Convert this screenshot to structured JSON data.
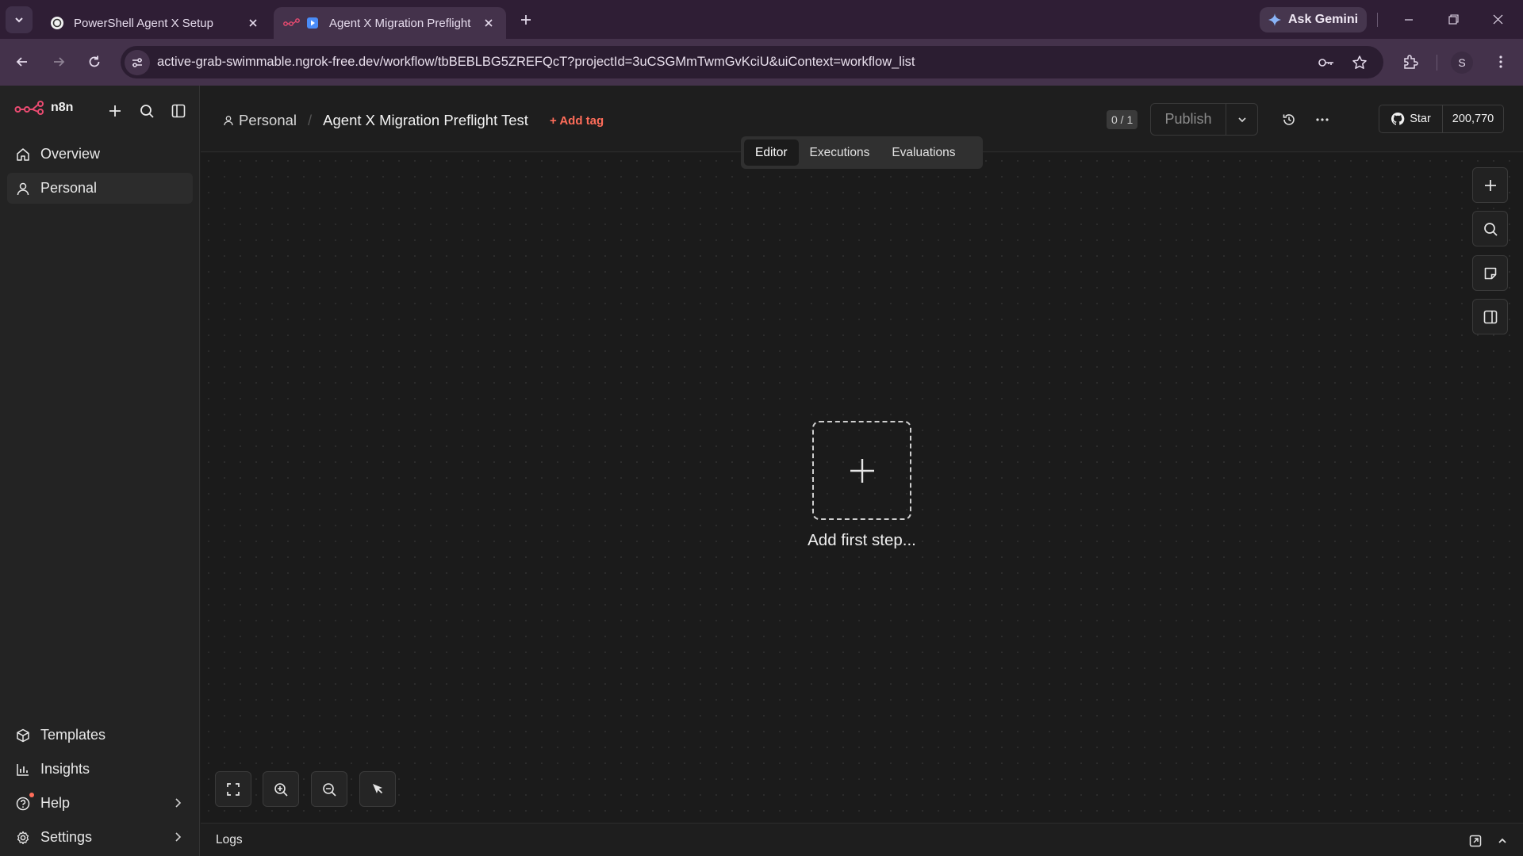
{
  "browser": {
    "tabs": [
      {
        "title": "PowerShell Agent X Setup",
        "active": false
      },
      {
        "title": "Agent X Migration Preflight",
        "active": true
      }
    ],
    "gemini_label": "Ask Gemini",
    "url": "active-grab-swimmable.ngrok-free.dev/workflow/tbBEBLBG5ZREFQcT?projectId=3uCSGMmTwmGvKciU&uiContext=workflow_list",
    "profile_initial": "S"
  },
  "sidebar": {
    "brand": "n8n",
    "top_items": [
      {
        "label": "Overview",
        "icon": "home-icon"
      },
      {
        "label": "Personal",
        "icon": "user-icon"
      }
    ],
    "bottom_items": [
      {
        "label": "Templates",
        "icon": "box-icon"
      },
      {
        "label": "Insights",
        "icon": "bar-chart-icon"
      },
      {
        "label": "Help",
        "icon": "help-icon"
      },
      {
        "label": "Settings",
        "icon": "gear-icon"
      }
    ]
  },
  "header": {
    "project": "Personal",
    "workflow_name": "Agent X Migration Preflight Test",
    "add_tag": "+ Add tag",
    "counter": "0 / 1",
    "publish": "Publish",
    "github_star": "Star",
    "github_count": "200,770"
  },
  "view_tabs": [
    "Editor",
    "Executions",
    "Evaluations"
  ],
  "canvas": {
    "first_step_label": "Add first step..."
  },
  "logs": {
    "label": "Logs"
  },
  "colors": {
    "accent": "#ff6d5a",
    "tab_bar": "#2f1e35",
    "toolbar": "#44324b",
    "canvas": "#1b1b1b"
  }
}
